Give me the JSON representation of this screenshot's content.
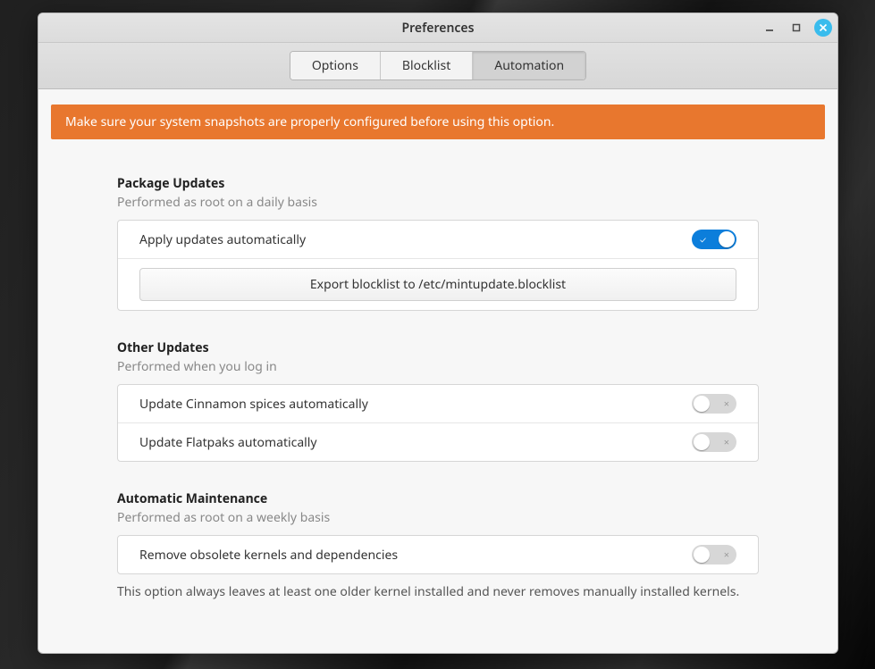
{
  "window": {
    "title": "Preferences"
  },
  "tabs": {
    "options": "Options",
    "blocklist": "Blocklist",
    "automation": "Automation"
  },
  "banner": "Make sure your system snapshots are properly configured before using this option.",
  "sections": {
    "package": {
      "title": "Package Updates",
      "subtitle": "Performed as root on a daily basis",
      "row_apply": "Apply updates automatically",
      "export_btn": "Export blocklist to /etc/mintupdate.blocklist"
    },
    "other": {
      "title": "Other Updates",
      "subtitle": "Performed when you log in",
      "row_spices": "Update Cinnamon spices automatically",
      "row_flatpak": "Update Flatpaks automatically"
    },
    "maint": {
      "title": "Automatic Maintenance",
      "subtitle": "Performed as root on a weekly basis",
      "row_kernel": "Remove obsolete kernels and dependencies",
      "note": "This option always leaves at least one older kernel installed and never removes manually installed kernels."
    }
  },
  "toggles": {
    "apply_updates": true,
    "spices": false,
    "flatpak": false,
    "kernel": false
  }
}
